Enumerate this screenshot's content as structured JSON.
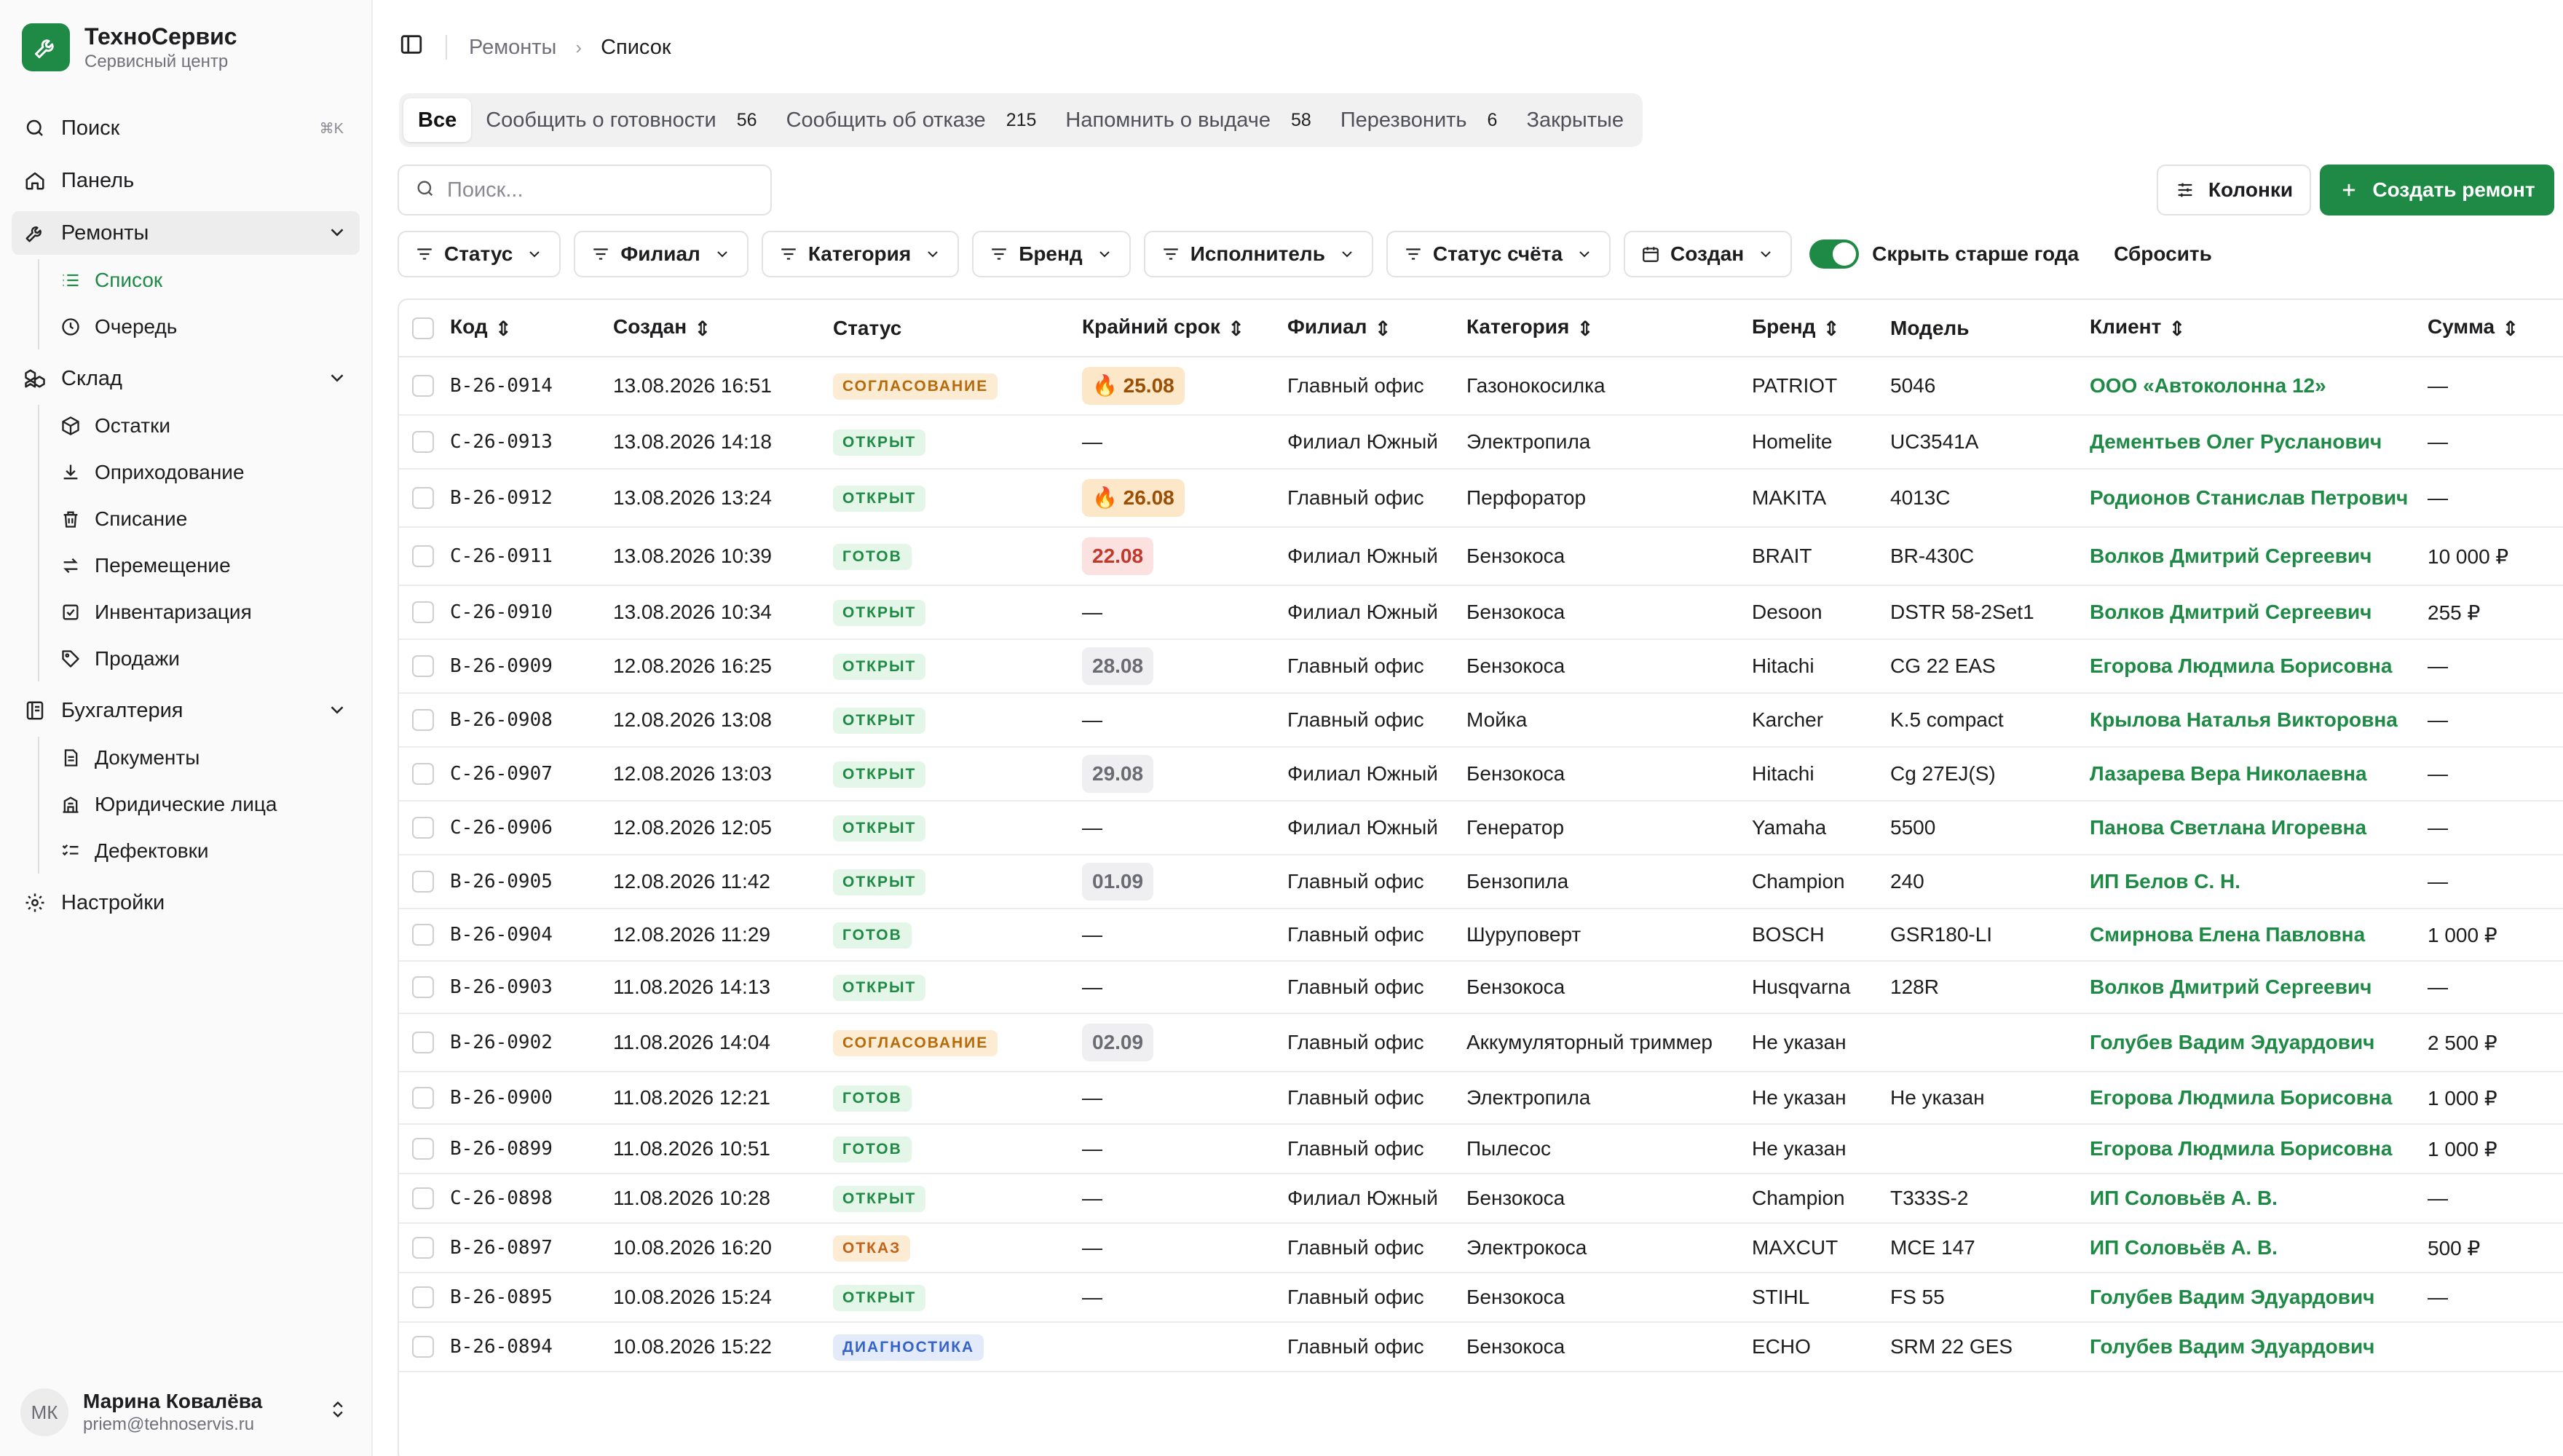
{
  "brand": {
    "name": "ТехноСервис",
    "subtitle": "Сервисный центр"
  },
  "sidebar": {
    "search_label": "Поиск",
    "search_shortcut": "⌘K",
    "dashboard": "Панель",
    "repairs": {
      "label": "Ремонты",
      "items": [
        "Список",
        "Очередь"
      ]
    },
    "warehouse": {
      "label": "Склад",
      "items": [
        "Остатки",
        "Оприходование",
        "Списание",
        "Перемещение",
        "Инвентаризация",
        "Продажи"
      ]
    },
    "accounting": {
      "label": "Бухгалтерия",
      "items": [
        "Документы",
        "Юридические лица",
        "Дефектовки"
      ]
    },
    "settings": "Настройки"
  },
  "user": {
    "initials": "МК",
    "name": "Марина Ковалёва",
    "email": "priem@tehnoservis.ru"
  },
  "breadcrumb": {
    "parent": "Ремонты",
    "current": "Список"
  },
  "tabs": [
    {
      "label": "Все",
      "count": ""
    },
    {
      "label": "Сообщить о готовности",
      "count": "56"
    },
    {
      "label": "Сообщить об отказе",
      "count": "215"
    },
    {
      "label": "Напомнить о выдаче",
      "count": "58"
    },
    {
      "label": "Перезвонить",
      "count": "6"
    },
    {
      "label": "Закрытые",
      "count": ""
    }
  ],
  "search": {
    "placeholder": "Поиск..."
  },
  "toolbar": {
    "columns": "Колонки",
    "create": "Создать ремонт"
  },
  "filters": [
    "Статус",
    "Филиал",
    "Категория",
    "Бренд",
    "Исполнитель",
    "Статус счёта",
    "Создан"
  ],
  "toggle_label": "Скрыть старше года",
  "reset": "Сбросить",
  "colors": {
    "accent": "#1e8a45"
  },
  "table": {
    "headers": {
      "code": "Код",
      "created": "Создан",
      "status": "Статус",
      "deadline": "Крайний срок",
      "branch": "Филиал",
      "category": "Категория",
      "brand": "Бренд",
      "model": "Модель",
      "client": "Клиент",
      "sum": "Сумма"
    },
    "rows": [
      {
        "code": "B-26-0914",
        "created": "13.08.2026 16:51",
        "status": "СОГЛАСОВАНИЕ",
        "st": "agree",
        "deadline": "25.08",
        "dl": "fire",
        "branch": "Главный офис",
        "category": "Газонокосилка",
        "brand": "PATRIOT",
        "model": "5046",
        "client": "ООО «Автоколонна 12»",
        "sum": "—"
      },
      {
        "code": "C-26-0913",
        "created": "13.08.2026 14:18",
        "status": "ОТКРЫТ",
        "st": "open",
        "deadline": "—",
        "dl": "none",
        "branch": "Филиал Южный",
        "category": "Электропила",
        "brand": "Homelite",
        "model": "UC3541A",
        "client": "Дементьев Олег Русланович",
        "sum": "—"
      },
      {
        "code": "B-26-0912",
        "created": "13.08.2026 13:24",
        "status": "ОТКРЫТ",
        "st": "open",
        "deadline": "26.08",
        "dl": "fire",
        "branch": "Главный офис",
        "category": "Перфоратор",
        "brand": "MAKITA",
        "model": "4013C",
        "client": "Родионов Станислав Петрович",
        "sum": "—"
      },
      {
        "code": "C-26-0911",
        "created": "13.08.2026 10:39",
        "status": "ГОТОВ",
        "st": "ready",
        "deadline": "22.08",
        "dl": "red",
        "branch": "Филиал Южный",
        "category": "Бензокоса",
        "brand": "BRAIT",
        "model": "BR-430C",
        "client": "Волков Дмитрий Сергеевич",
        "sum": "10 000 ₽"
      },
      {
        "code": "C-26-0910",
        "created": "13.08.2026 10:34",
        "status": "ОТКРЫТ",
        "st": "open",
        "deadline": "—",
        "dl": "none",
        "branch": "Филиал Южный",
        "category": "Бензокоса",
        "brand": "Desoon",
        "model": "DSTR 58-2Set1",
        "client": "Волков Дмитрий Сергеевич",
        "sum": "255 ₽"
      },
      {
        "code": "B-26-0909",
        "created": "12.08.2026 16:25",
        "status": "ОТКРЫТ",
        "st": "open",
        "deadline": "28.08",
        "dl": "gray",
        "branch": "Главный офис",
        "category": "Бензокоса",
        "brand": "Hitachi",
        "model": "CG 22 EAS",
        "client": "Егорова Людмила Борисовна",
        "sum": "—"
      },
      {
        "code": "B-26-0908",
        "created": "12.08.2026 13:08",
        "status": "ОТКРЫТ",
        "st": "open",
        "deadline": "—",
        "dl": "none",
        "branch": "Главный офис",
        "category": "Мойка",
        "brand": "Karcher",
        "model": "K.5 compact",
        "client": "Крылова Наталья Викторовна",
        "sum": "—"
      },
      {
        "code": "C-26-0907",
        "created": "12.08.2026 13:03",
        "status": "ОТКРЫТ",
        "st": "open",
        "deadline": "29.08",
        "dl": "gray",
        "branch": "Филиал Южный",
        "category": "Бензокоса",
        "brand": "Hitachi",
        "model": "Cg 27EJ(S)",
        "client": "Лазарева Вера Николаевна",
        "sum": "—"
      },
      {
        "code": "C-26-0906",
        "created": "12.08.2026 12:05",
        "status": "ОТКРЫТ",
        "st": "open",
        "deadline": "—",
        "dl": "none",
        "branch": "Филиал Южный",
        "category": "Генератор",
        "brand": "Yamaha",
        "model": "5500",
        "client": "Панова Светлана Игоревна",
        "sum": "—"
      },
      {
        "code": "B-26-0905",
        "created": "12.08.2026 11:42",
        "status": "ОТКРЫТ",
        "st": "open",
        "deadline": "01.09",
        "dl": "gray",
        "branch": "Главный офис",
        "category": "Бензопила",
        "brand": "Champion",
        "model": "240",
        "client": "ИП Белов С. Н.",
        "sum": "—"
      },
      {
        "code": "B-26-0904",
        "created": "12.08.2026 11:29",
        "status": "ГОТОВ",
        "st": "ready",
        "deadline": "—",
        "dl": "none",
        "branch": "Главный офис",
        "category": "Шуруповерт",
        "brand": "BOSCH",
        "model": "GSR180-LI",
        "client": "Смирнова Елена Павловна",
        "sum": "1 000 ₽"
      },
      {
        "code": "B-26-0903",
        "created": "11.08.2026 14:13",
        "status": "ОТКРЫТ",
        "st": "open",
        "deadline": "—",
        "dl": "none",
        "branch": "Главный офис",
        "category": "Бензокоса",
        "brand": "Husqvarna",
        "model": "128R",
        "client": "Волков Дмитрий Сергеевич",
        "sum": "—"
      },
      {
        "code": "B-26-0902",
        "created": "11.08.2026 14:04",
        "status": "СОГЛАСОВАНИЕ",
        "st": "agree",
        "deadline": "02.09",
        "dl": "gray",
        "branch": "Главный офис",
        "category": "Аккумуляторный триммер",
        "brand": "Не указан",
        "model": "",
        "client": "Голубев Вадим Эдуардович",
        "sum": "2 500 ₽"
      },
      {
        "code": "B-26-0900",
        "created": "11.08.2026 12:21",
        "status": "ГОТОВ",
        "st": "ready",
        "deadline": "—",
        "dl": "none",
        "branch": "Главный офис",
        "category": "Электропила",
        "brand": "Не указан",
        "model": "Не указан",
        "client": "Егорова Людмила Борисовна",
        "sum": "1 000 ₽"
      },
      {
        "code": "B-26-0899",
        "created": "11.08.2026 10:51",
        "status": "ГОТОВ",
        "st": "ready",
        "deadline": "—",
        "dl": "none",
        "branch": "Главный офис",
        "category": "Пылесос",
        "brand": "Не указан",
        "model": "",
        "client": "Егорова Людмила Борисовна",
        "sum": "1 000 ₽"
      },
      {
        "code": "C-26-0898",
        "created": "11.08.2026 10:28",
        "status": "ОТКРЫТ",
        "st": "open",
        "deadline": "—",
        "dl": "none",
        "branch": "Филиал Южный",
        "category": "Бензокоса",
        "brand": "Champion",
        "model": "T333S-2",
        "client": "ИП Соловьёв А. В.",
        "sum": "—"
      },
      {
        "code": "B-26-0897",
        "created": "10.08.2026 16:20",
        "status": "ОТКАЗ",
        "st": "refuse",
        "deadline": "—",
        "dl": "none",
        "branch": "Главный офис",
        "category": "Электрокоса",
        "brand": "MAXCUT",
        "model": "MCE 147",
        "client": "ИП Соловьёв А. В.",
        "sum": "500 ₽"
      },
      {
        "code": "B-26-0895",
        "created": "10.08.2026 15:24",
        "status": "ОТКРЫТ",
        "st": "open",
        "deadline": "—",
        "dl": "none",
        "branch": "Главный офис",
        "category": "Бензокоса",
        "brand": "STIHL",
        "model": "FS 55",
        "client": "Голубев Вадим Эдуардович",
        "sum": "—"
      },
      {
        "code": "B-26-0894",
        "created": "10.08.2026 15:22",
        "status": "ДИАГНОСТИКА",
        "st": "diag",
        "deadline": "",
        "dl": "none",
        "branch": "Главный офис",
        "category": "Бензокоса",
        "brand": "ECHO",
        "model": "SRM 22 GES",
        "client": "Голубев Вадим Эдуардович",
        "sum": ""
      }
    ]
  }
}
